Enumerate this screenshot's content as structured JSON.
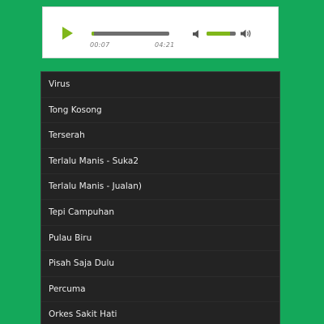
{
  "player": {
    "current_time": "00:07",
    "total_time": "04:21",
    "progress": 0.03,
    "volume": 0.8,
    "colors": {
      "accent": "#80b71a",
      "track": "#6e6e6e",
      "background": "#14a85a",
      "list_background": "#232323"
    },
    "icons": {
      "play": "play-icon",
      "mute": "speaker-mute-icon",
      "volume_max": "speaker-volume-max-icon"
    }
  },
  "playlist": {
    "tracks": [
      "Virus",
      "Tong Kosong",
      "Terserah",
      "Terlalu Manis - Suka2",
      "Terlalu Manis - Jualan)",
      "Tepi Campuhan",
      "Pulau Biru",
      "Pisah Saja Dulu",
      "Percuma",
      "Orkes Sakit Hati"
    ]
  }
}
